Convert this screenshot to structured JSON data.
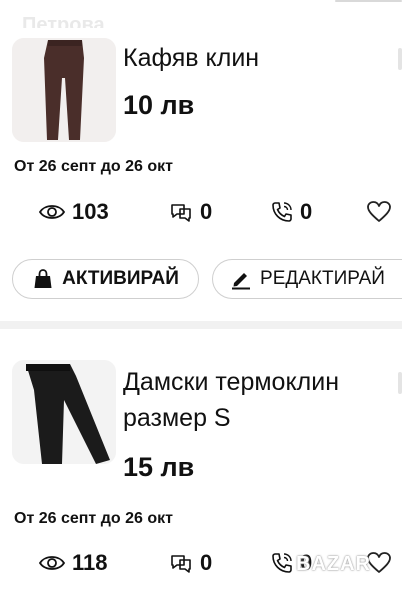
{
  "header": {
    "seller_name": "Петрова"
  },
  "listings": [
    {
      "title": "Кафяв клин",
      "price": "10 лв",
      "dates": "От 26 септ до 26 окт",
      "views": "103",
      "messages": "0",
      "calls": "0",
      "activate_label": "АКТИВИРАЙ",
      "edit_label": "РЕДАКТИРАЙ",
      "image_color": "#4a2e2a"
    },
    {
      "title_line1": "Дамски термоклин",
      "title_line2": "размер S",
      "price": "15 лв",
      "dates": "От 26 септ до 26 окт",
      "views": "118",
      "messages": "0",
      "calls": "0",
      "image_color": "#1b1b1b"
    }
  ],
  "watermark": "BAZAR",
  "colors": {
    "divider": "#f1f1f1",
    "button_border": "#cfcfcf",
    "text": "#111111"
  }
}
